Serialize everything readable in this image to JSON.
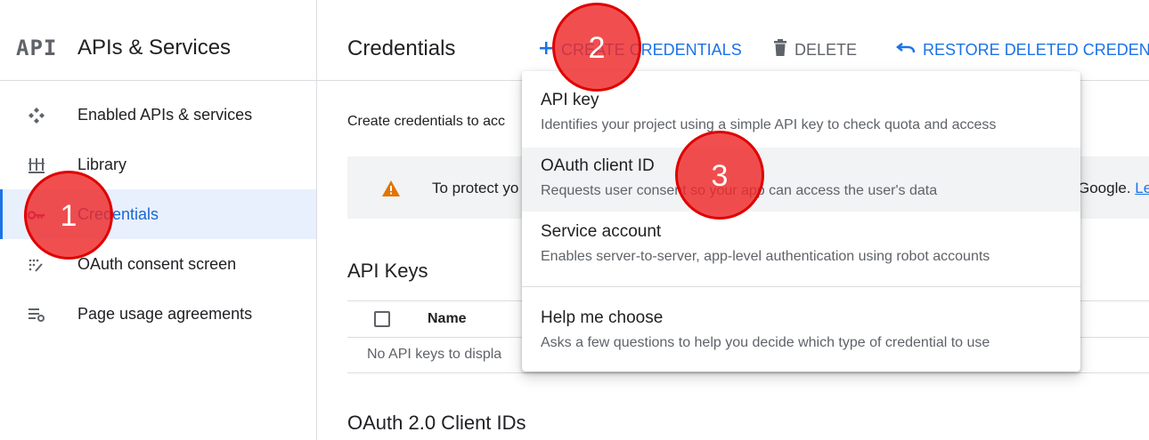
{
  "sidebar": {
    "logo_text": "API",
    "product_title": "APIs & Services",
    "items": [
      {
        "label": "Enabled APIs & services",
        "icon": "diamond-arrows-icon"
      },
      {
        "label": "Library",
        "icon": "library-icon"
      },
      {
        "label": "Credentials",
        "icon": "key-icon",
        "active": true
      },
      {
        "label": "OAuth consent screen",
        "icon": "consent-icon"
      },
      {
        "label": "Page usage agreements",
        "icon": "settings-list-icon"
      }
    ]
  },
  "topbar": {
    "title": "Credentials",
    "create_label": "CREATE CREDENTIALS",
    "delete_label": "DELETE",
    "restore_label": "RESTORE DELETED CREDENTIA"
  },
  "main": {
    "intro": "Create credentials to acc",
    "banner": {
      "text": "To protect yo",
      "tail_text": "Google.",
      "link": "Le"
    },
    "api_keys": {
      "title": "API Keys",
      "col_name": "Name",
      "empty_text": "No API keys to displa"
    },
    "oauth_title": "OAuth 2.0 Client IDs"
  },
  "menu": {
    "items": [
      {
        "title": "API key",
        "desc": "Identifies your project using a simple API key to check quota and access"
      },
      {
        "title": "OAuth client ID",
        "desc": "Requests user consent so your app can access the user's data"
      },
      {
        "title": "Service account",
        "desc": "Enables server-to-server, app-level authentication using robot accounts"
      },
      {
        "title": "Help me choose",
        "desc": "Asks a few questions to help you decide which type of credential to use"
      }
    ]
  },
  "markers": [
    "1",
    "2",
    "3"
  ],
  "colors": {
    "accent": "#1a73e8",
    "active_bg": "#e8f0fe",
    "warning": "#e37400",
    "marker": "#ee2828"
  }
}
